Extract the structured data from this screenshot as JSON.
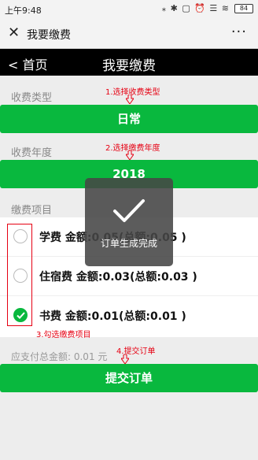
{
  "statusbar": {
    "time": "上午9:48",
    "icons": "⁎ ✱ ▢ ⏰ ☰ ≋",
    "battery": "84"
  },
  "wechat": {
    "title": "我要缴费",
    "more": "···"
  },
  "navbar": {
    "back": "< 首页",
    "title": "我要缴费"
  },
  "fee_type": {
    "label": "收费类型",
    "value": "日常",
    "annotation": "1.选择收费类型"
  },
  "fee_year": {
    "label": "收费年度",
    "value": "2018",
    "annotation": "2.选择缴费年度"
  },
  "fee_items": {
    "label": "缴费项目",
    "annotation": "3.勾选缴费项目",
    "items": [
      {
        "text": "学费  金额:0.05(总额:0.05 )",
        "checked": false
      },
      {
        "text": "住宿费  金额:0.03(总额:0.03 )",
        "checked": false
      },
      {
        "text": "书费  金额:0.01(总额:0.01 )",
        "checked": true
      }
    ]
  },
  "total": {
    "text": "应支付总金额: 0.01 元"
  },
  "submit": {
    "label": "提交订单",
    "annotation": "4.提交订单"
  },
  "toast": {
    "message": "订单生成完成"
  },
  "colors": {
    "primary": "#09b83e",
    "annotation": "#e60012",
    "navbar": "#000000"
  }
}
